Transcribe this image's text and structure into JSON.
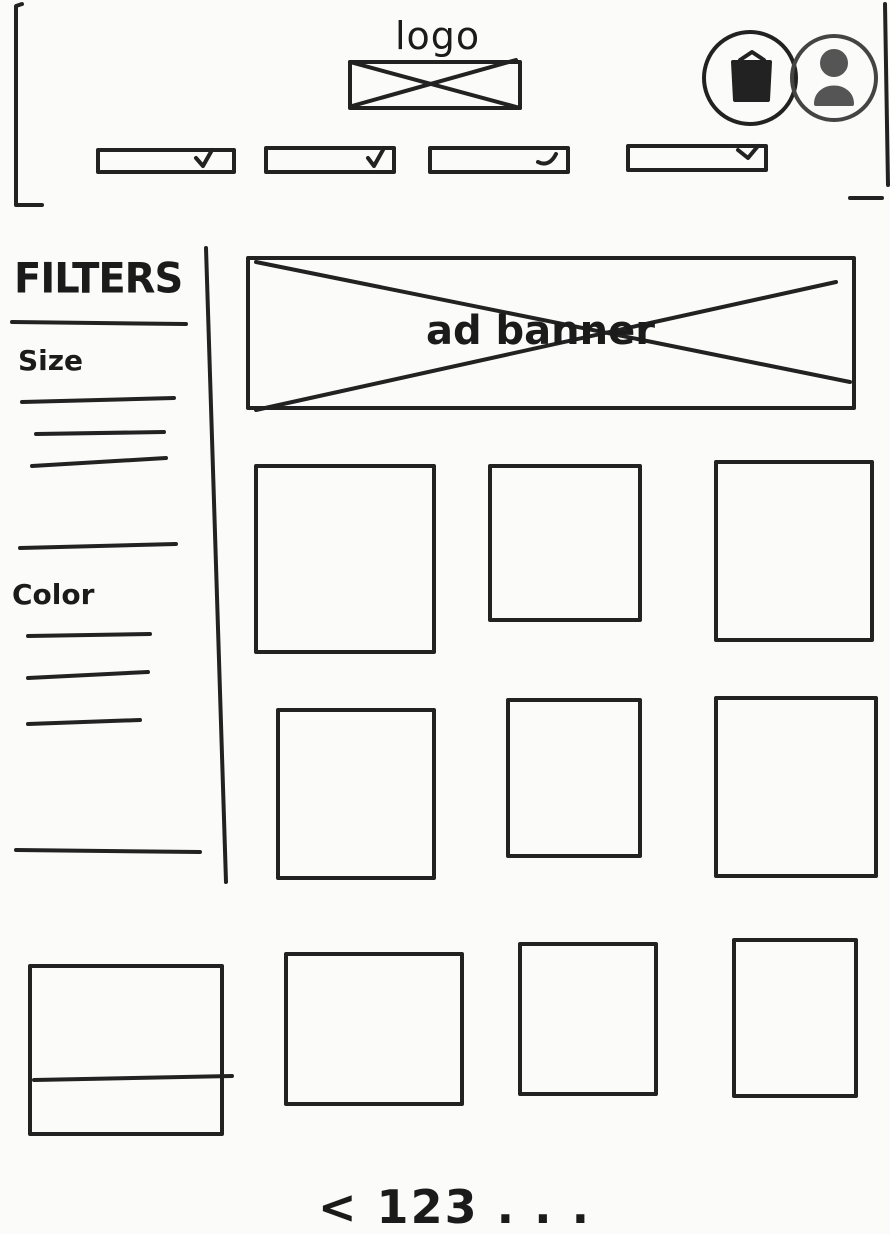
{
  "header": {
    "logo_label": "logo",
    "nav_items": [
      "",
      "",
      "",
      ""
    ],
    "icons": [
      "cart-icon",
      "user-icon"
    ]
  },
  "sidebar": {
    "title": "FILTERS",
    "sections": [
      {
        "label": "Size",
        "options_count": 3
      },
      {
        "label": "Color",
        "options_count": 3
      }
    ]
  },
  "banner": {
    "label": "ad banner"
  },
  "product_grid": {
    "rows": 3,
    "items": 10
  },
  "pagination": {
    "label": "< 123 . . ."
  }
}
